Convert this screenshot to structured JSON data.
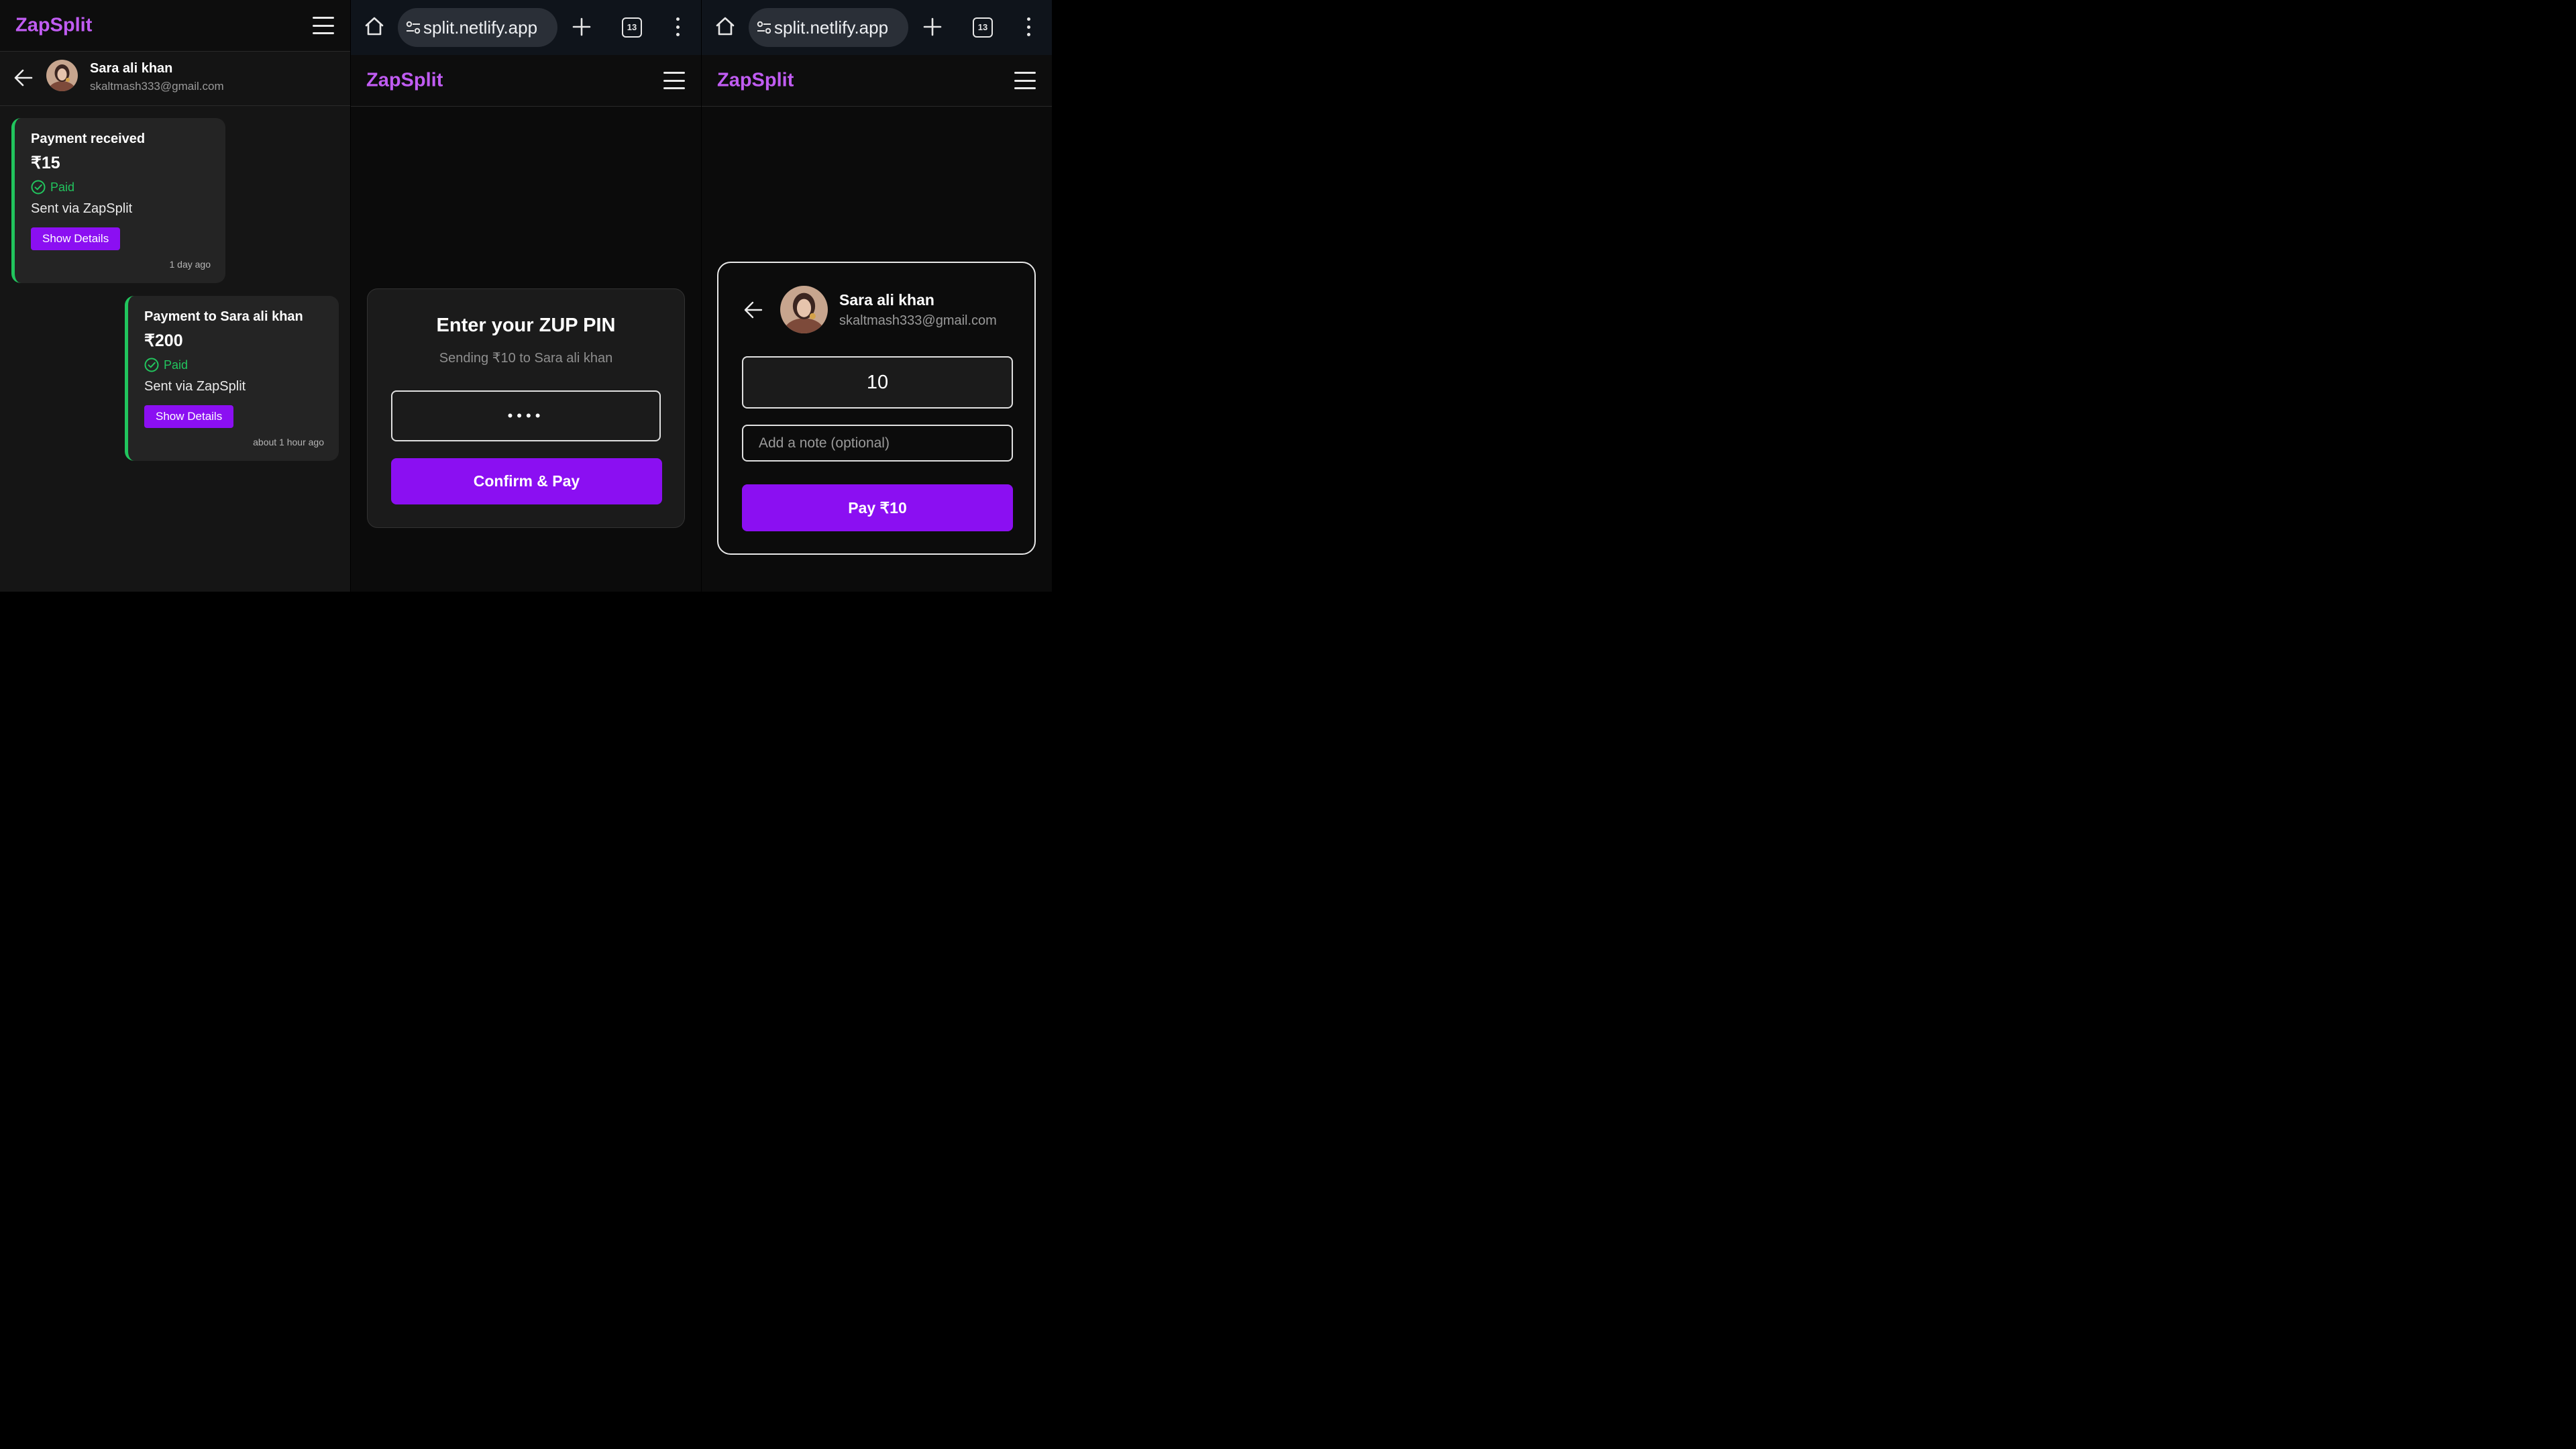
{
  "brand": {
    "name": "ZapSplit",
    "color": "#c05cf2"
  },
  "browser": {
    "url": "split.netlify.app",
    "tab_count": "13"
  },
  "contact": {
    "name": "Sara ali khan",
    "email": "skaltmash333@gmail.com"
  },
  "chat": {
    "messages": [
      {
        "title": "Payment received",
        "amount": "₹15",
        "status": "Paid",
        "via": "Sent via ZapSplit",
        "button": "Show Details",
        "time": "1 day ago"
      },
      {
        "title": "Payment to Sara ali khan",
        "amount": "₹200",
        "status": "Paid",
        "via": "Sent via ZapSplit",
        "button": "Show Details",
        "time": "about 1 hour ago"
      }
    ]
  },
  "pin_dialog": {
    "title": "Enter your ZUP PIN",
    "subtitle": "Sending ₹10 to Sara ali khan",
    "pin_value": "••••",
    "confirm_label": "Confirm & Pay"
  },
  "pay_form": {
    "amount": "10",
    "note_placeholder": "Add a note (optional)",
    "pay_label": "Pay ₹10"
  },
  "colors": {
    "accent": "#8b0ff2",
    "success": "#22c55e"
  },
  "icons": [
    "hamburger-menu-icon",
    "back-arrow-icon",
    "home-icon",
    "site-settings-icon",
    "plus-icon",
    "tabs-icon",
    "more-vert-icon",
    "check-circle-icon"
  ]
}
